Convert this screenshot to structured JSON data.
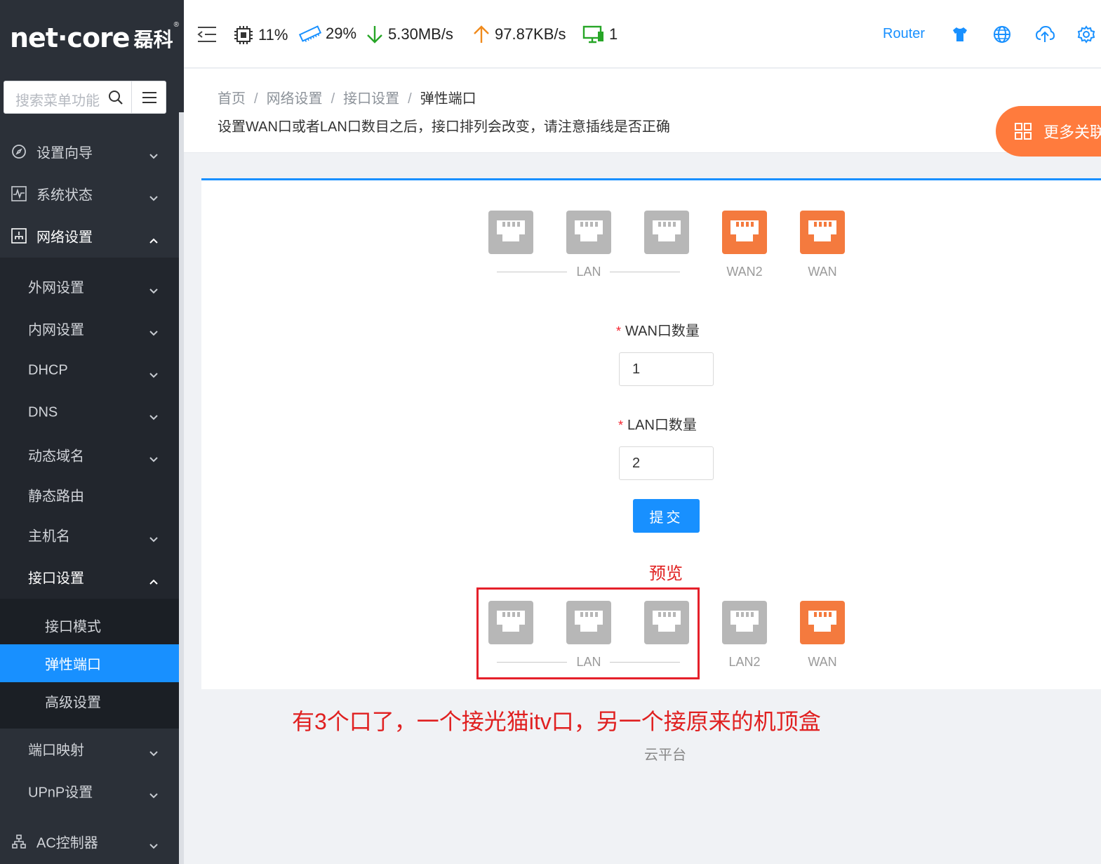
{
  "sidebar": {
    "logo_brand": "net·core",
    "logo_cn": "磊科",
    "logo_reg": "®",
    "search_placeholder": "搜索菜单功能",
    "items": [
      {
        "label": "设置向导"
      },
      {
        "label": "系统状态"
      },
      {
        "label": "网络设置"
      },
      {
        "label": "外网设置"
      },
      {
        "label": "内网设置"
      },
      {
        "label": "DHCP"
      },
      {
        "label": "DNS"
      },
      {
        "label": "动态域名"
      },
      {
        "label": "静态路由"
      },
      {
        "label": "主机名"
      },
      {
        "label": "接口设置"
      },
      {
        "label": "接口模式"
      },
      {
        "label": "弹性端口"
      },
      {
        "label": "高级设置"
      },
      {
        "label": "端口映射"
      },
      {
        "label": "UPnP设置"
      },
      {
        "label": "AC控制器"
      }
    ]
  },
  "topbar": {
    "cpu": "11%",
    "memory": "29%",
    "download": "5.30MB/s",
    "upload": "97.87KB/s",
    "devices": "1",
    "router_label": "Router"
  },
  "header": {
    "breadcrumb": [
      "首页",
      "网络设置",
      "接口设置",
      "弹性端口"
    ],
    "separator": "/",
    "description": "设置WAN口或者LAN口数目之后，接口排列会改变，请注意插线是否正确",
    "more_button": "更多关联"
  },
  "ports_current": {
    "lan_label": "LAN",
    "ports": [
      {
        "type": "lan",
        "color": "grey"
      },
      {
        "type": "lan",
        "color": "grey"
      },
      {
        "type": "lan",
        "color": "grey"
      },
      {
        "type": "wan",
        "color": "orange",
        "label": "WAN2"
      },
      {
        "type": "wan",
        "color": "orange",
        "label": "WAN"
      }
    ]
  },
  "form": {
    "wan_label": "WAN口数量",
    "wan_value": "1",
    "lan_label": "LAN口数量",
    "lan_value": "2",
    "required_mark": "*",
    "submit_label": "提交"
  },
  "preview": {
    "title": "预览",
    "lan_label": "LAN",
    "ports": [
      {
        "type": "lan",
        "color": "grey"
      },
      {
        "type": "lan",
        "color": "grey"
      },
      {
        "type": "lan",
        "color": "grey"
      },
      {
        "type": "lan",
        "color": "grey",
        "label": "LAN2"
      },
      {
        "type": "wan",
        "color": "orange",
        "label": "WAN"
      }
    ]
  },
  "annotation": "有3个口了，一个接光猫itv口，另一个接原来的机顶盒",
  "footer": "云平台",
  "colors": {
    "accent": "#1890ff",
    "sidebar_bg": "#2b3038",
    "port_orange": "#f47a3e",
    "port_grey": "#b7b7b7",
    "annotation_red": "#e02020"
  }
}
